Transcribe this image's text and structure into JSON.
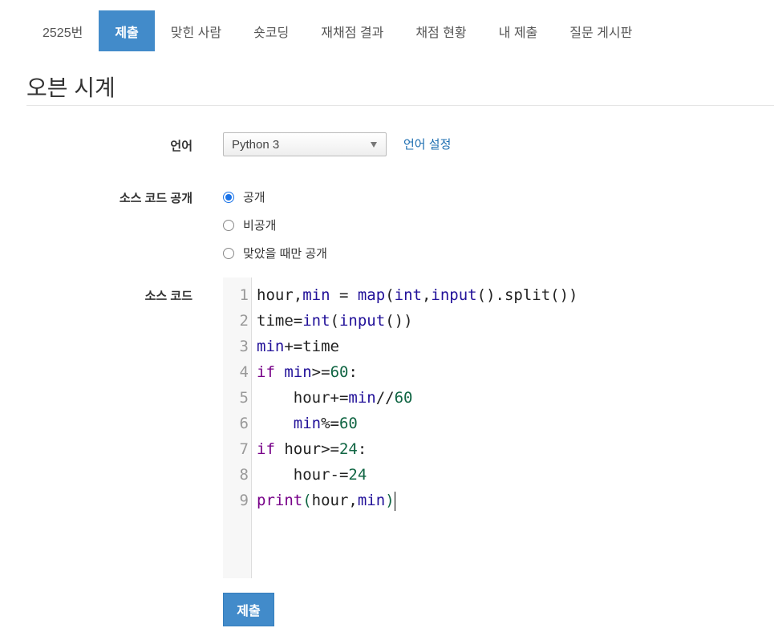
{
  "tabs": [
    {
      "label": "2525번",
      "active": false
    },
    {
      "label": "제출",
      "active": true
    },
    {
      "label": "맞힌 사람",
      "active": false
    },
    {
      "label": "숏코딩",
      "active": false
    },
    {
      "label": "재채점 결과",
      "active": false
    },
    {
      "label": "채점 현황",
      "active": false
    },
    {
      "label": "내 제출",
      "active": false
    },
    {
      "label": "질문 게시판",
      "active": false
    }
  ],
  "page_title": "오븐 시계",
  "form": {
    "language_label": "언어",
    "language_value": "Python 3",
    "language_settings_link": "언어 설정",
    "visibility_label": "소스 코드 공개",
    "visibility_options": [
      {
        "label": "공개",
        "checked": true
      },
      {
        "label": "비공개",
        "checked": false
      },
      {
        "label": "맞았을 때만 공개",
        "checked": false
      }
    ],
    "source_label": "소스 코드",
    "submit_label": "제출"
  },
  "code": {
    "line_numbers": [
      "1",
      "2",
      "3",
      "4",
      "5",
      "6",
      "7",
      "8",
      "9"
    ],
    "segments": {
      "l1": [
        "hour,",
        "min",
        " = ",
        "map",
        "(",
        "int",
        ",",
        "input",
        "().split())"
      ],
      "l2": [
        "time=",
        "int",
        "(",
        "input",
        "())"
      ],
      "l3": [
        "min",
        "+=time"
      ],
      "l4": [
        "if",
        " ",
        "min",
        ">=",
        "60",
        ":"
      ],
      "l5": [
        "    hour+=",
        "min",
        "//",
        "60"
      ],
      "l6": [
        "    ",
        "min",
        "%=",
        "60"
      ],
      "l7": [
        "if",
        " hour>=",
        "24",
        ":"
      ],
      "l8": [
        "    hour-=",
        "24"
      ],
      "l9": [
        "print",
        "(",
        "hour,",
        "min",
        ")"
      ]
    }
  },
  "colors": {
    "accent": "#428bca",
    "link": "#1e6fb1",
    "radio_checked": "#1a73e8",
    "keyword": "#770088",
    "number": "#116644",
    "builtin": "#221199"
  }
}
